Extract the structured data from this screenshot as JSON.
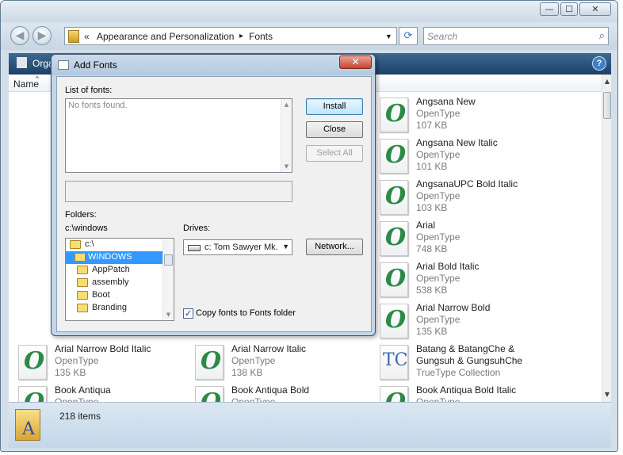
{
  "window": {
    "minimize_label": "—",
    "maximize_label": "☐",
    "close_label": "✕"
  },
  "nav": {
    "back_label": "◀",
    "forward_label": "▶",
    "breadcrumb": [
      "«",
      "Appearance and Personalization",
      "▸",
      "Fonts"
    ],
    "refresh_icon": "⟳",
    "search_placeholder": "Search",
    "search_icon": "🔍"
  },
  "toolbar": {
    "organize_label": "Orga",
    "help_label": "?"
  },
  "columns": {
    "name_label": "Name"
  },
  "fonts": [
    {
      "name": "Angsana New",
      "type": "OpenType",
      "size": "107 KB",
      "icon": "opentype-icon"
    },
    {
      "name": "Angsana New Italic",
      "type": "OpenType",
      "size": "101 KB",
      "icon": "opentype-icon"
    },
    {
      "name": "AngsanaUPC Bold Italic",
      "type": "OpenType",
      "size": "103 KB",
      "icon": "opentype-icon"
    },
    {
      "name": "Arial",
      "type": "OpenType",
      "size": "748 KB",
      "icon": "opentype-icon"
    },
    {
      "name": "Arial Bold Italic",
      "type": "OpenType",
      "size": "538 KB",
      "icon": "opentype-icon"
    },
    {
      "name": "Arial Narrow Bold",
      "type": "OpenType",
      "size": "135 KB",
      "icon": "opentype-icon"
    },
    {
      "name": "Arial Narrow Bold Italic",
      "type": "OpenType",
      "size": "135 KB",
      "icon": "opentype-icon"
    },
    {
      "name": "Arial Narrow Italic",
      "type": "OpenType",
      "size": "138 KB",
      "icon": "opentype-icon"
    },
    {
      "name": "Batang & BatangChe &",
      "name2": "Gungsuh & GungsuhChe",
      "type": "TrueType Collection",
      "icon": "truetype-collection-icon"
    },
    {
      "name": "Book Antiqua",
      "type": "OpenType",
      "icon": "opentype-icon"
    },
    {
      "name": "Book Antiqua Bold",
      "type": "OpenType",
      "icon": "opentype-icon"
    },
    {
      "name": "Book Antiqua Bold Italic",
      "type": "OpenType",
      "icon": "opentype-icon"
    }
  ],
  "details": {
    "item_count": "218 items"
  },
  "dialog": {
    "title": "Add Fonts",
    "close_label": "✕",
    "list_label": "List of fonts:",
    "list_empty": "No fonts found.",
    "install_label": "Install",
    "close_button_label": "Close",
    "select_all_label": "Select All",
    "folders_label": "Folders:",
    "current_folder": "c:\\windows",
    "folder_tree": [
      "c:\\",
      "WINDOWS",
      "AppPatch",
      "assembly",
      "Boot",
      "Branding"
    ],
    "drives_label": "Drives:",
    "drive_value": "c: Tom Sawyer Mk.",
    "network_label": "Network...",
    "copy_label": "Copy fonts to Fonts folder",
    "copy_checked": true,
    "check_mark": "✓"
  }
}
